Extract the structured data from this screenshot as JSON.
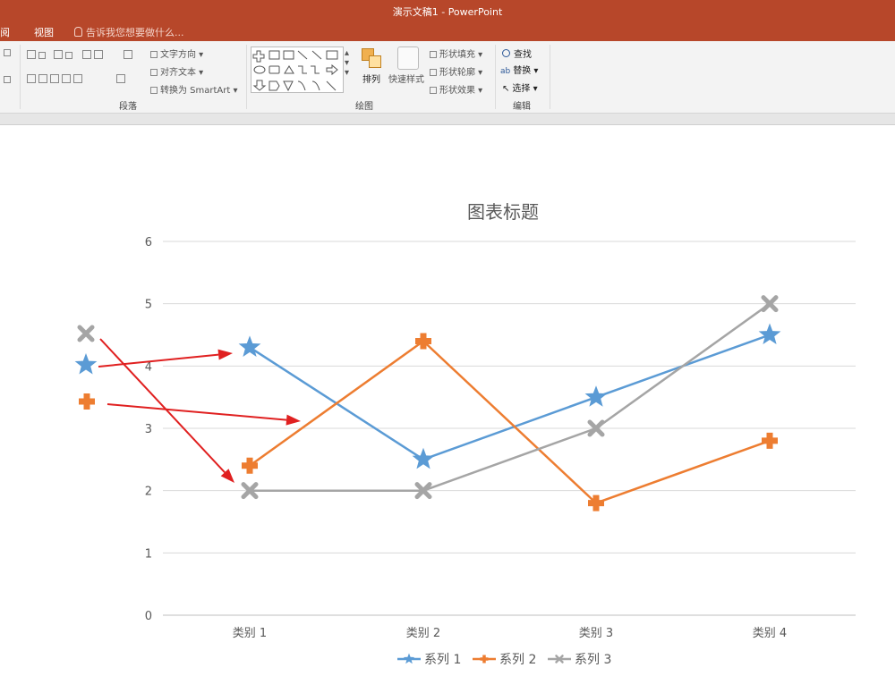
{
  "window": {
    "title": "演示文稿1 - PowerPoint"
  },
  "menu": {
    "items": [
      "阅",
      "视图"
    ],
    "tell_me": "告诉我您想要做什么..."
  },
  "ribbon": {
    "paragraph": {
      "label": "段落",
      "text_direction": "文字方向",
      "align_text": "对齐文本",
      "convert_smartart": "转换为 SmartArt"
    },
    "drawing": {
      "label": "绘图",
      "arrange": "排列",
      "quick_styles": "快速样式",
      "shape_fill": "形状填充",
      "shape_outline": "形状轮廓",
      "shape_effects": "形状效果"
    },
    "editing": {
      "label": "编辑",
      "find": "查找",
      "replace": "替换",
      "select": "选择"
    }
  },
  "colors": {
    "accent": "#b7472a",
    "series1": "#5b9bd5",
    "series2": "#ed7d31",
    "series3": "#a5a5a5",
    "arrow": "#e02020"
  },
  "chart_data": {
    "type": "line",
    "title": "图表标题",
    "categories": [
      "类别 1",
      "类别 2",
      "类别 3",
      "类别 4"
    ],
    "ylim": [
      0,
      6
    ],
    "yticks": [
      "0",
      "1",
      "2",
      "3",
      "4",
      "5",
      "6"
    ],
    "grid": true,
    "legend": "bottom",
    "series": [
      {
        "name": "系列 1",
        "values": [
          4.3,
          2.5,
          3.5,
          4.5
        ],
        "color": "#5b9bd5",
        "marker": "star"
      },
      {
        "name": "系列 2",
        "values": [
          2.4,
          4.4,
          1.8,
          2.8
        ],
        "color": "#ed7d31",
        "marker": "plus"
      },
      {
        "name": "系列 3",
        "values": [
          2,
          2,
          3,
          5
        ],
        "color": "#a5a5a5",
        "marker": "x"
      }
    ]
  }
}
